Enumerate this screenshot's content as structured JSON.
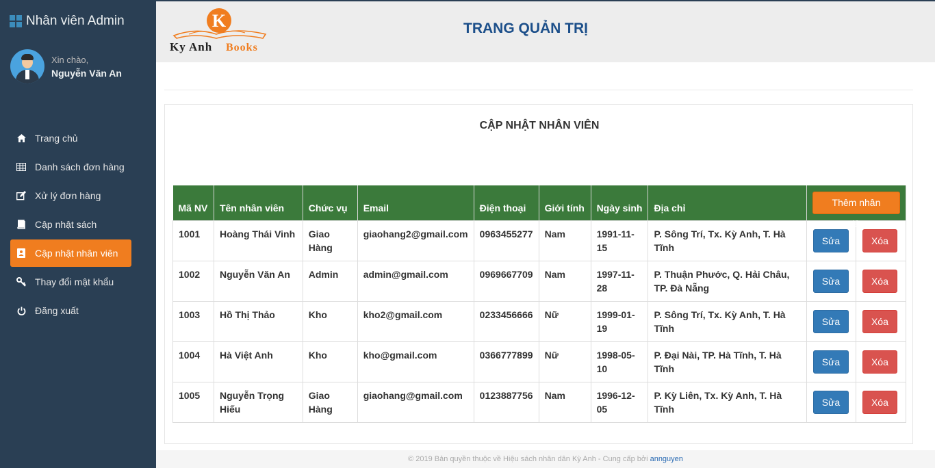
{
  "sidebar": {
    "brand": "Nhân viên Admin",
    "greeting": "Xin chào,",
    "username": "Nguyễn Văn An",
    "items": [
      {
        "label": "Trang chủ",
        "icon": "home-icon",
        "active": false
      },
      {
        "label": "Danh sách đơn hàng",
        "icon": "table-icon",
        "active": false
      },
      {
        "label": "Xử lý đơn hàng",
        "icon": "edit-icon",
        "active": false
      },
      {
        "label": "Cập nhật sách",
        "icon": "book-icon",
        "active": false
      },
      {
        "label": "Cập nhật nhân viên",
        "icon": "contact-book-icon",
        "active": true
      },
      {
        "label": "Thay đổi mật khẩu",
        "icon": "key-icon",
        "active": false
      },
      {
        "label": "Đăng xuất",
        "icon": "power-icon",
        "active": false
      }
    ]
  },
  "header": {
    "logo_text_1": "Ky Anh",
    "logo_text_2": "Books",
    "title": "TRANG QUẢN TRỊ"
  },
  "panel": {
    "title": "CẬP NHẬT NHÂN VIÊN",
    "add_button": "Thêm nhân viên",
    "edit_label": "Sửa",
    "delete_label": "Xóa",
    "columns": [
      "Mã NV",
      "Tên nhân viên",
      "Chức vụ",
      "Email",
      "Điện thoại",
      "Giới tính",
      "Ngày sinh",
      "Địa chỉ"
    ],
    "rows": [
      [
        "1001",
        "Hoàng Thái Vinh",
        "Giao Hàng",
        "giaohang2@gmail.com",
        "0963455277",
        "Nam",
        "1991-11-15",
        "P. Sông Trí, Tx. Kỳ Anh, T. Hà Tĩnh"
      ],
      [
        "1002",
        "Nguyễn Văn An",
        "Admin",
        "admin@gmail.com",
        "0969667709",
        "Nam",
        "1997-11-28",
        "P. Thuận Phước, Q. Hải Châu, TP. Đà Nẵng"
      ],
      [
        "1003",
        "Hồ Thị Thảo",
        "Kho",
        "kho2@gmail.com",
        "0233456666",
        "Nữ",
        "1999-01-19",
        "P. Sông Trí, Tx. Kỳ Anh, T. Hà Tĩnh"
      ],
      [
        "1004",
        "Hà Việt Anh",
        "Kho",
        "kho@gmail.com",
        "0366777899",
        "Nữ",
        "1998-05-10",
        "P. Đại Nài, TP. Hà Tĩnh, T. Hà Tĩnh"
      ],
      [
        "1005",
        "Nguyễn Trọng Hiếu",
        "Giao Hàng",
        "giaohang@gmail.com",
        "0123887756",
        "Nam",
        "1996-12-05",
        "P. Kỳ Liên, Tx. Kỳ Anh, T. Hà Tĩnh"
      ]
    ]
  },
  "footer": {
    "text": "© 2019 Bản quyền thuộc về Hiệu sách nhân dân Kỳ Anh - Cung cấp bởi ",
    "link": "annguyen"
  },
  "colors": {
    "sidebar_bg": "#2a3f54",
    "accent": "#f07d1f",
    "table_header": "#3b7a3b",
    "edit": "#337ab7",
    "delete": "#d9534f",
    "title": "#1c4f8a"
  }
}
